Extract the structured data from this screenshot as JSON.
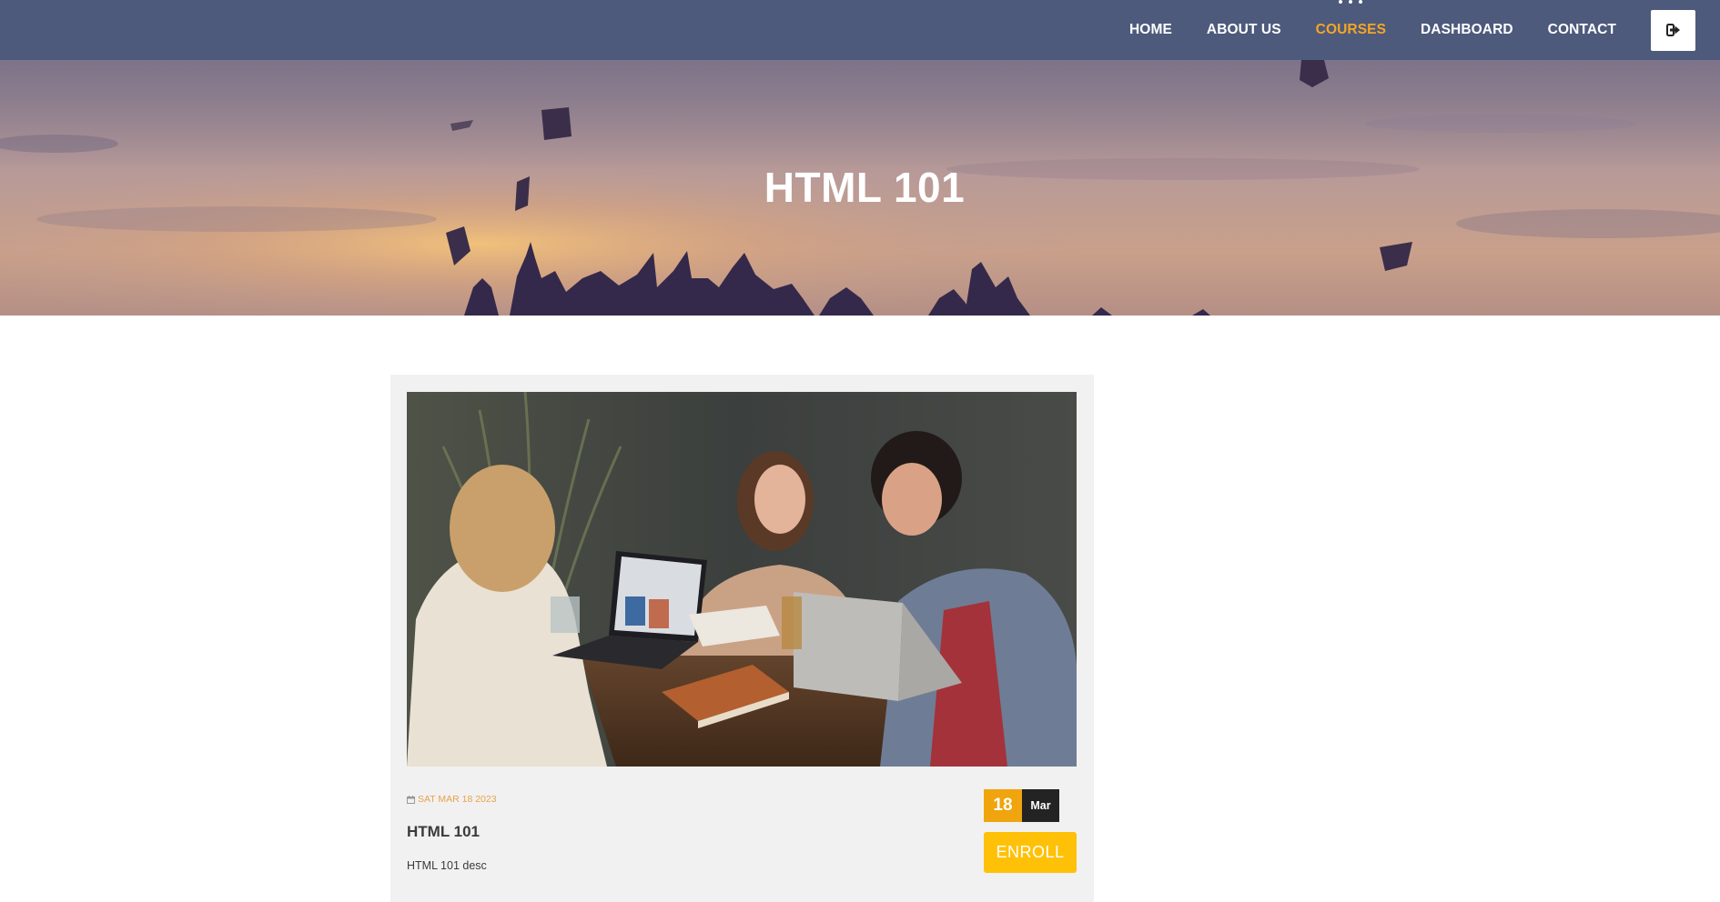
{
  "nav": {
    "items": [
      {
        "label": "HOME",
        "active": false
      },
      {
        "label": "ABOUT US",
        "active": false
      },
      {
        "label": "COURSES",
        "active": true
      },
      {
        "label": "DASHBOARD",
        "active": false
      },
      {
        "label": "CONTACT",
        "active": false
      }
    ],
    "logout_icon": "sign-out-icon"
  },
  "hero": {
    "title": "HTML 101"
  },
  "course": {
    "date_icon": "calendar-icon",
    "date_text": "SAT MAR 18 2023",
    "title": "HTML 101",
    "description": "HTML 101 desc",
    "badge_day": "18",
    "badge_month": "Mar",
    "enroll_label": "ENROLL"
  },
  "colors": {
    "navbar": "#4d5a7c",
    "active_nav": "#f5a623",
    "badge_day": "#f0a40e",
    "badge_month": "#232323",
    "enroll_button": "#ffc107",
    "card_background": "#f1f1f1",
    "date_text": "#e8a24b"
  }
}
